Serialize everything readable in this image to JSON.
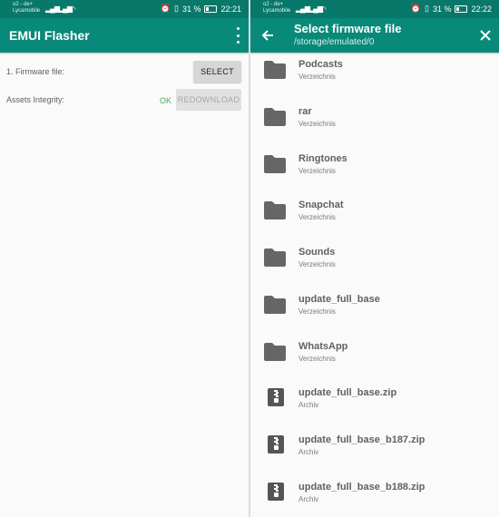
{
  "left": {
    "status": {
      "carrier_line1": "o2 - de+",
      "carrier_line2": "Lycamobile",
      "battery": "31 %",
      "time": "22:21"
    },
    "app_title": "EMUI Flasher",
    "firmware_label": "1. Firmware file:",
    "select_label": "SELECT",
    "assets_label": "Assets Integrity:",
    "ok_text": "OK",
    "redownload_label": "REDOWNLOAD"
  },
  "right": {
    "status": {
      "carrier_line1": "o2 - de+",
      "carrier_line2": "Lycamobile",
      "battery": "31 %",
      "time": "22:22"
    },
    "title": "Select firmware file",
    "path": "/storage/emulated/0",
    "files": [
      {
        "name": "Podcasts",
        "type": "Verzeichnis",
        "icon": "folder-icon"
      },
      {
        "name": "rar",
        "type": "Verzeichnis",
        "icon": "folder-icon"
      },
      {
        "name": "Ringtones",
        "type": "Verzeichnis",
        "icon": "folder-icon"
      },
      {
        "name": "Snapchat",
        "type": "Verzeichnis",
        "icon": "folder-icon"
      },
      {
        "name": "Sounds",
        "type": "Verzeichnis",
        "icon": "folder-icon"
      },
      {
        "name": "update_full_base",
        "type": "Verzeichnis",
        "icon": "folder-icon"
      },
      {
        "name": "WhatsApp",
        "type": "Verzeichnis",
        "icon": "folder-icon"
      },
      {
        "name": "update_full_base.zip",
        "type": "Archiv",
        "icon": "archive-icon"
      },
      {
        "name": "update_full_base_b187.zip",
        "type": "Archiv",
        "icon": "archive-icon"
      },
      {
        "name": "update_full_base_b188.zip",
        "type": "Archiv",
        "icon": "archive-icon"
      }
    ]
  },
  "colors": {
    "status_bar": "#08786a",
    "app_bar": "#09897a",
    "ok_green": "#4caf50",
    "background": "#fafafa"
  }
}
